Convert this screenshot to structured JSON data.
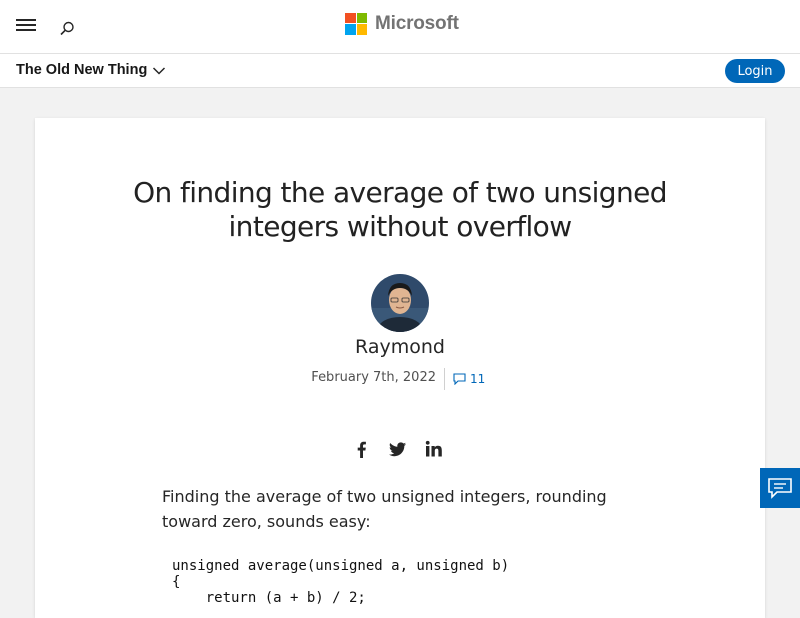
{
  "header": {
    "brand": "Microsoft",
    "brand_colors": [
      "#f25022",
      "#7fba00",
      "#00a4ef",
      "#ffb900"
    ],
    "menu_icon": "hamburger-icon",
    "search_icon": "search-icon"
  },
  "blogbar": {
    "name": "The Old New Thing",
    "login_label": "Login",
    "accent": "#0067b8"
  },
  "article": {
    "title": "On finding the average of two unsigned integers without overflow",
    "author": "Raymond",
    "date": "February 7th, 2022",
    "comment_count": "11",
    "share_icons": [
      "facebook-icon",
      "twitter-icon",
      "linkedin-icon"
    ],
    "intro": "Finding the average of two unsigned integers, rounding toward zero, sounds easy:",
    "code_lines": [
      "unsigned average(unsigned a, unsigned b)",
      "{",
      "    return (a + b) / 2;"
    ]
  },
  "feedback": {
    "icon": "feedback-icon"
  }
}
